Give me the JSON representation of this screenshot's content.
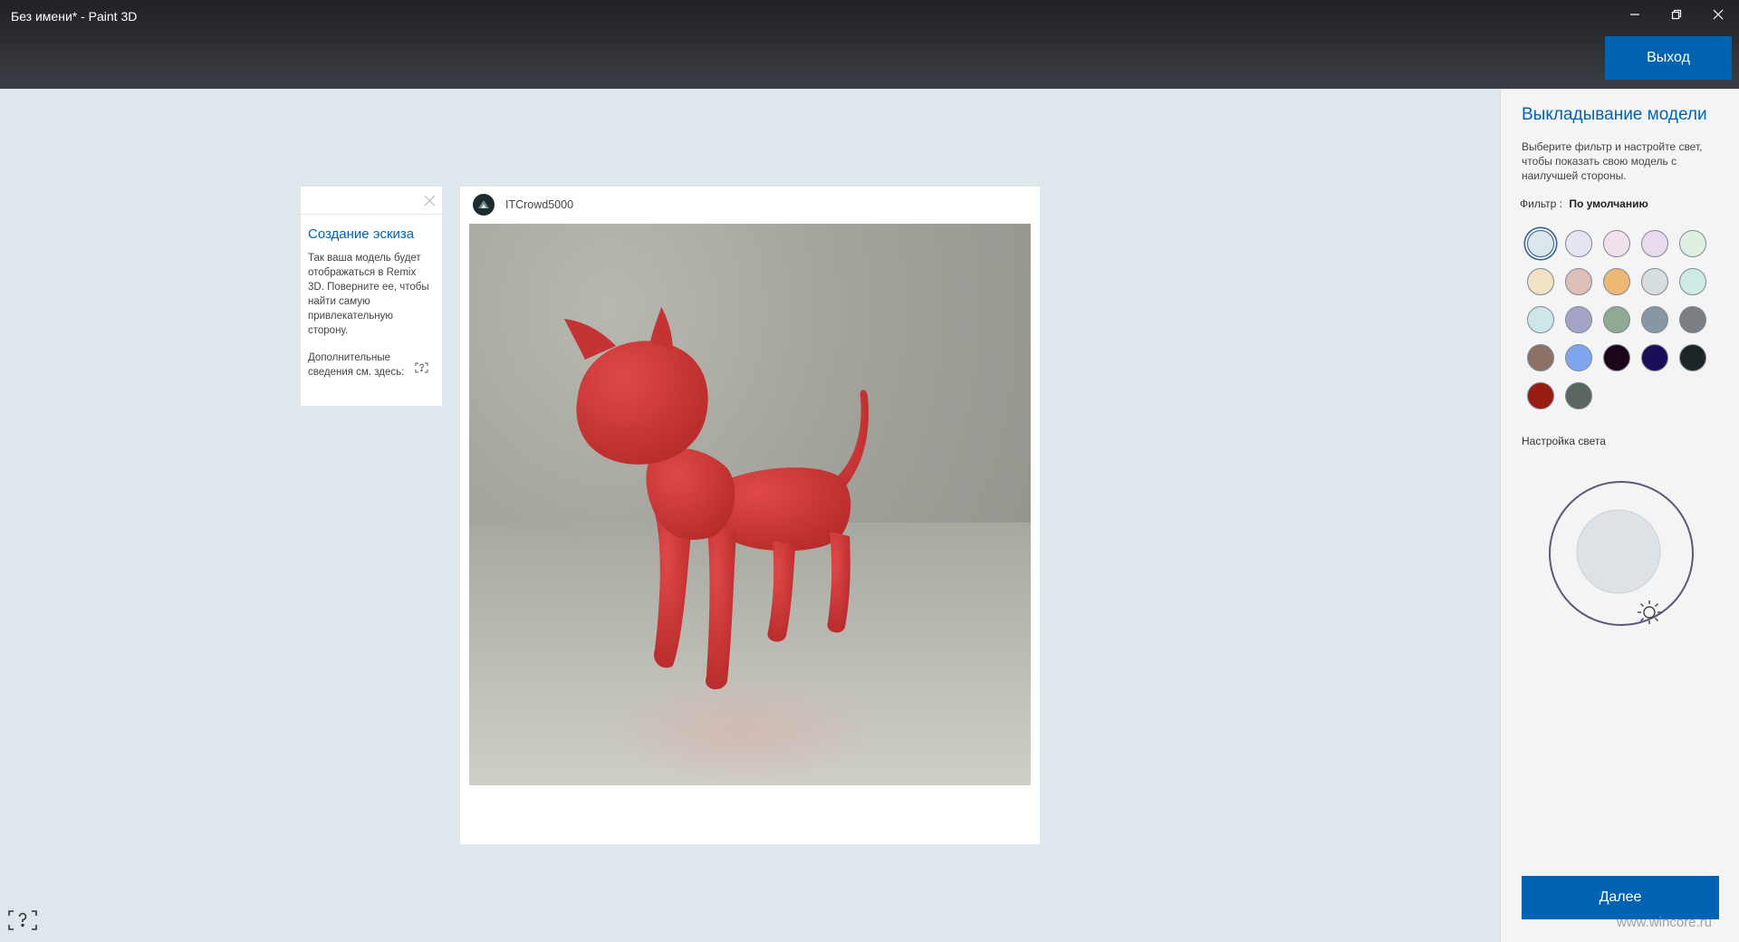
{
  "window": {
    "title": "Без имени* - Paint 3D",
    "controls": [
      "minimize-icon",
      "restore-icon",
      "close-icon"
    ]
  },
  "header": {
    "exit_label": "Выход",
    "accent_color": "#0063b1"
  },
  "tip": {
    "title": "Создание эскиза",
    "body": "Так ваша модель будет отображаться в Remix 3D. Поверните ее, чтобы найти самую привлекательную сторону.",
    "more": "Дополнительные сведения см. здесь:"
  },
  "preview": {
    "username": "ITCrowd5000",
    "subject": "red cat model",
    "model_color": "#d63a3a"
  },
  "panel": {
    "title": "Выкладывание модели",
    "description": "Выберите фильтр и настройте свет, чтобы показать свою модель с наилучшей стороны.",
    "filter_label": "Фильтр :",
    "filter_value": "По умолчанию",
    "swatches": [
      {
        "color": "#dbe5ec",
        "selected": true
      },
      {
        "color": "#e5e6f2",
        "selected": false
      },
      {
        "color": "#f1e1ea",
        "selected": false
      },
      {
        "color": "#e8dbee",
        "selected": false
      },
      {
        "color": "#dff0e2",
        "selected": false
      },
      {
        "color": "#f1e2c5",
        "selected": false
      },
      {
        "color": "#dfbfba",
        "selected": false
      },
      {
        "color": "#edb876",
        "selected": false
      },
      {
        "color": "#d6dedf",
        "selected": false
      },
      {
        "color": "#cfeae5",
        "selected": false
      },
      {
        "color": "#cde7e8",
        "selected": false
      },
      {
        "color": "#a4a5c6",
        "selected": false
      },
      {
        "color": "#90a993",
        "selected": false
      },
      {
        "color": "#8797a5",
        "selected": false
      },
      {
        "color": "#7a7f84",
        "selected": false
      },
      {
        "color": "#8c7165",
        "selected": false
      },
      {
        "color": "#7ea5ee",
        "selected": false
      },
      {
        "color": "#1b0716",
        "selected": false
      },
      {
        "color": "#1c0f5a",
        "selected": false
      },
      {
        "color": "#1d2529",
        "selected": false
      },
      {
        "color": "#981d12",
        "selected": false
      },
      {
        "color": "#5b6660",
        "selected": false
      }
    ],
    "light_label": "Настройка света",
    "next_label": "Далее"
  },
  "watermark": "www.wincore.ru"
}
